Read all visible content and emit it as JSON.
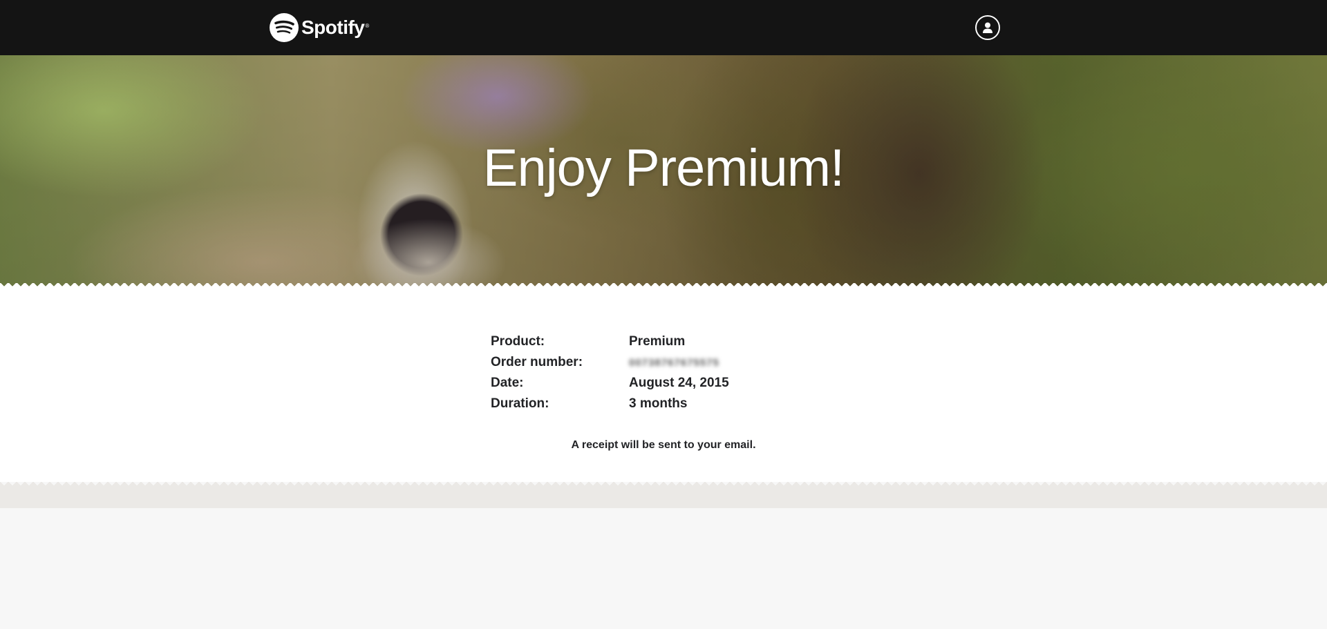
{
  "header": {
    "brand": "Spotify",
    "brand_mark": "®",
    "logo_icon": "spotify-logo-icon",
    "user_icon": "user-account-icon"
  },
  "hero": {
    "title": "Enjoy Premium!"
  },
  "order": {
    "rows": [
      {
        "label": "Product:",
        "value": "Premium"
      },
      {
        "label": "Order number:",
        "value": "00738767675575"
      },
      {
        "label": "Date:",
        "value": "August 24, 2015"
      },
      {
        "label": "Duration:",
        "value": "3 months"
      }
    ],
    "note": "A receipt will be sent to your email."
  },
  "colors": {
    "topbar": "#141414",
    "text": "#222326",
    "band": "#ebe9e6",
    "page": "#f7f7f7"
  }
}
